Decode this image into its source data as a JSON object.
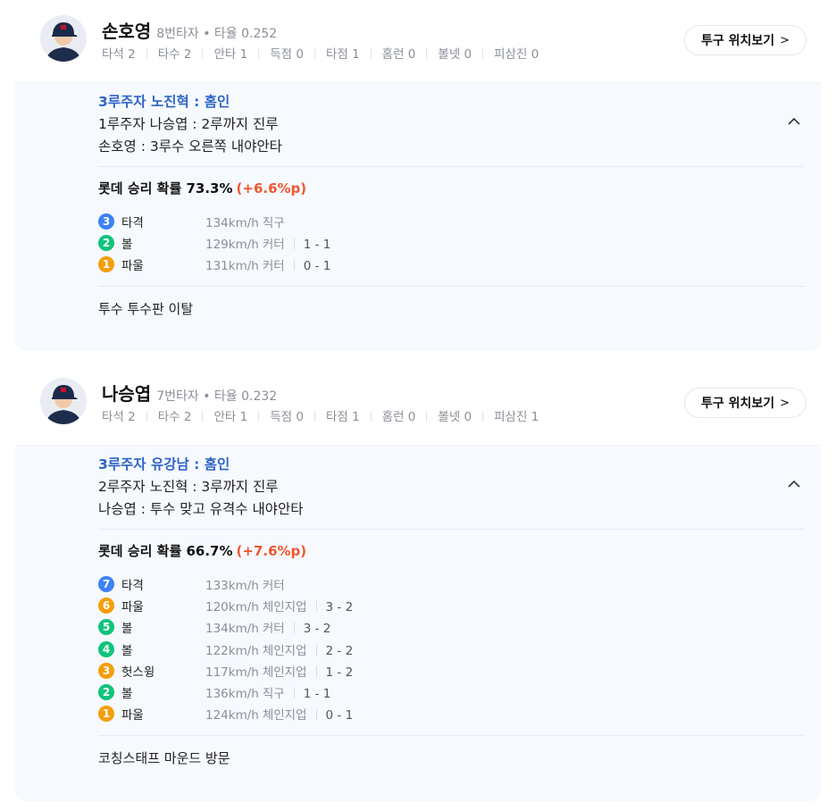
{
  "colors": {
    "accent_blue": "#2e64c8",
    "delta_red": "#f0572f",
    "strike_blue": "#3b82f6",
    "ball_green": "#10c47a",
    "foul_orange": "#f59e0b"
  },
  "plays": [
    {
      "player": {
        "name": "손호영",
        "order_avg": "8번타자 • 타율 0.252",
        "stats": [
          "타석 2",
          "타수 2",
          "안타 1",
          "득점 0",
          "타점 1",
          "홈런 0",
          "볼넷 0",
          "피삼진 0"
        ]
      },
      "pitch_button": "투구 위치보기",
      "event_main": "3루주자 노진혁 : 홈인",
      "event_lines": [
        "1루주자 나승엽 : 2루까지 진루",
        "손호영 : 3루수 오른쪽 내야안타"
      ],
      "win_prob": {
        "label": "롯데 승리 확률 73.3%",
        "delta": "(+6.6%p)"
      },
      "pitches": [
        {
          "num": "3",
          "result": "타격",
          "speed": "134km/h",
          "type": "직구",
          "count": "",
          "color": "#3b82f6"
        },
        {
          "num": "2",
          "result": "볼",
          "speed": "129km/h",
          "type": "커터",
          "count": "1 - 1",
          "color": "#10c47a"
        },
        {
          "num": "1",
          "result": "파울",
          "speed": "131km/h",
          "type": "커터",
          "count": "0 - 1",
          "color": "#f59e0b"
        }
      ],
      "note": "투수 투수판 이탈"
    },
    {
      "player": {
        "name": "나승엽",
        "order_avg": "7번타자 • 타율 0.232",
        "stats": [
          "타석 2",
          "타수 2",
          "안타 1",
          "득점 0",
          "타점 1",
          "홈런 0",
          "볼넷 0",
          "피삼진 1"
        ]
      },
      "pitch_button": "투구 위치보기",
      "event_main": "3루주자 유강남 : 홈인",
      "event_lines": [
        "2루주자 노진혁 : 3루까지 진루",
        "나승엽 : 투수 맞고 유격수 내야안타"
      ],
      "win_prob": {
        "label": "롯데 승리 확률 66.7%",
        "delta": "(+7.6%p)"
      },
      "pitches": [
        {
          "num": "7",
          "result": "타격",
          "speed": "133km/h",
          "type": "커터",
          "count": "",
          "color": "#3b82f6"
        },
        {
          "num": "6",
          "result": "파울",
          "speed": "120km/h",
          "type": "체인지업",
          "count": "3 - 2",
          "color": "#f59e0b"
        },
        {
          "num": "5",
          "result": "볼",
          "speed": "134km/h",
          "type": "커터",
          "count": "3 - 2",
          "color": "#10c47a"
        },
        {
          "num": "4",
          "result": "볼",
          "speed": "122km/h",
          "type": "체인지업",
          "count": "2 - 2",
          "color": "#10c47a"
        },
        {
          "num": "3",
          "result": "헛스윙",
          "speed": "117km/h",
          "type": "체인지업",
          "count": "1 - 2",
          "color": "#f59e0b"
        },
        {
          "num": "2",
          "result": "볼",
          "speed": "136km/h",
          "type": "직구",
          "count": "1 - 1",
          "color": "#10c47a"
        },
        {
          "num": "1",
          "result": "파울",
          "speed": "124km/h",
          "type": "체인지업",
          "count": "0 - 1",
          "color": "#f59e0b"
        }
      ],
      "note": "코칭스태프 마운드 방문"
    }
  ]
}
